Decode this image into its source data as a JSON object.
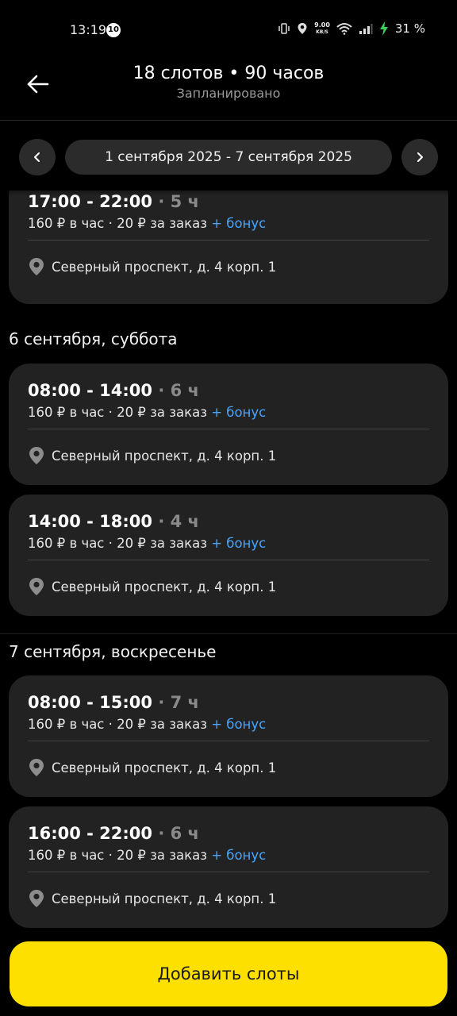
{
  "status_bar": {
    "time": "13:19",
    "notification_count": "10",
    "net_speed_value": "9.00",
    "net_speed_unit": "KB/S",
    "battery": "31 %",
    "icons": [
      "vibrate-icon",
      "location-icon",
      "wifi-icon",
      "signal-icon",
      "charging-icon"
    ]
  },
  "header": {
    "title": "18 слотов • 90 часов",
    "subtitle": "Запланировано"
  },
  "week_nav": {
    "range": "1 сентября 2025 - 7 сентября 2025"
  },
  "colors": {
    "background": "#000000",
    "card": "#222222",
    "accent_bonus": "#47a6ff",
    "primary_button": "#fde000",
    "duration_text": "#8a8a8a"
  },
  "slots_partial": [
    {
      "time": "17:00 - 22:00",
      "duration": " · 5 ч",
      "pay": "160 ₽ в час · 20 ₽ за заказ",
      "bonus": "+ бонус",
      "address": "Северный проспект, д. 4 корп. 1"
    }
  ],
  "days": [
    {
      "label": "6 сентября, суббота",
      "slots": [
        {
          "time": "08:00 - 14:00",
          "duration": " · 6 ч",
          "pay": "160 ₽ в час · 20 ₽ за заказ",
          "bonus": "+ бонус",
          "address": "Северный проспект, д. 4 корп. 1"
        },
        {
          "time": "14:00 - 18:00",
          "duration": " · 4 ч",
          "pay": "160 ₽ в час · 20 ₽ за заказ",
          "bonus": "+ бонус",
          "address": "Северный проспект, д. 4 корп. 1"
        }
      ]
    },
    {
      "label": "7 сентября, воскресенье",
      "slots": [
        {
          "time": "08:00 - 15:00",
          "duration": " · 7 ч",
          "pay": "160 ₽ в час · 20 ₽ за заказ",
          "bonus": "+ бонус",
          "address": "Северный проспект, д. 4 корп. 1"
        },
        {
          "time": "16:00 - 22:00",
          "duration": " · 6 ч",
          "pay": "160 ₽ в час · 20 ₽ за заказ",
          "bonus": "+ бонус",
          "address": "Северный проспект, д. 4 корп. 1"
        }
      ]
    }
  ],
  "add_button": "Добавить слоты"
}
